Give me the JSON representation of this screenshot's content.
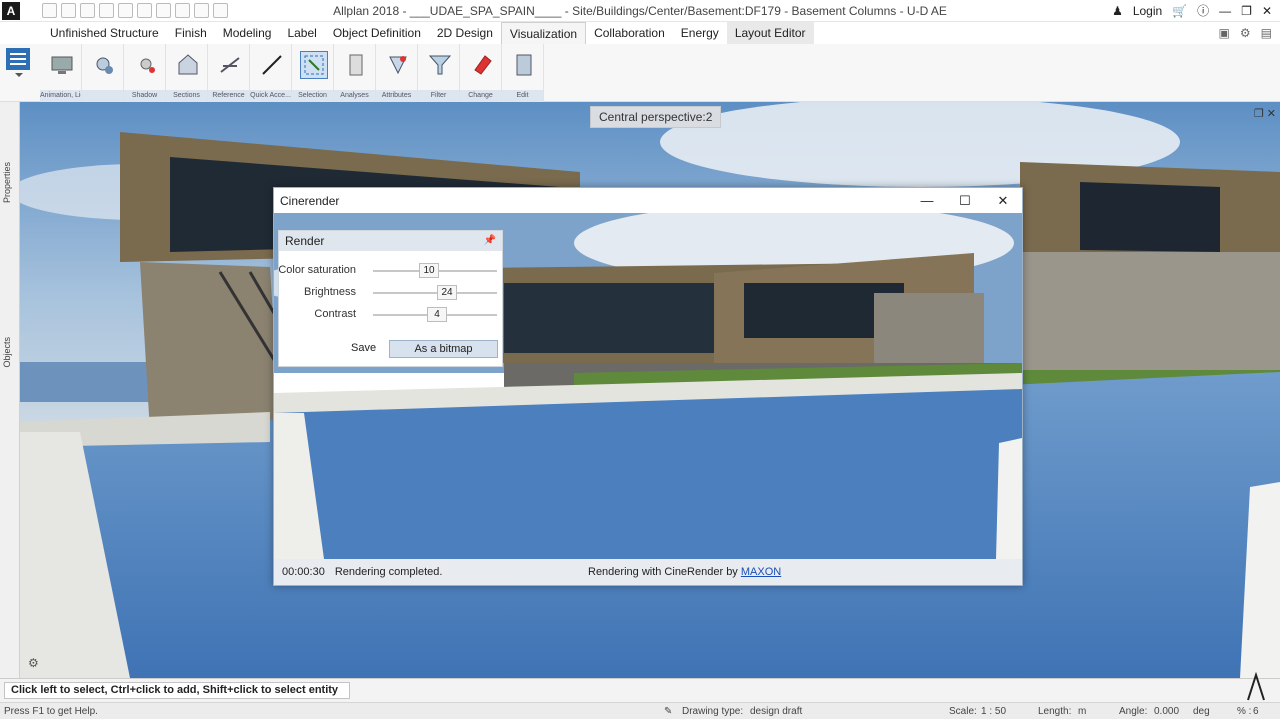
{
  "app": {
    "logo_letter": "A",
    "title": "Allplan 2018 - ___UDAE_SPA_SPAIN____ - Site/Buildings/Center/Basement:DF179 - Basement Columns - U-D AE",
    "login": "Login"
  },
  "ribbon_tabs": [
    {
      "label": "Unfinished Structure"
    },
    {
      "label": "Finish"
    },
    {
      "label": "Modeling"
    },
    {
      "label": "Label"
    },
    {
      "label": "Object Definition"
    },
    {
      "label": "2D Design"
    },
    {
      "label": "Visualization"
    },
    {
      "label": "Collaboration"
    },
    {
      "label": "Energy"
    },
    {
      "label": "Layout Editor"
    }
  ],
  "ribbon_groups": [
    {
      "label": "Animation, Light",
      "icon": "monitor-icon"
    },
    {
      "label": "",
      "icon": "light-settings-icon"
    },
    {
      "label": "Shadow",
      "icon": "sun-icon"
    },
    {
      "label": "Sections",
      "icon": "section-icon"
    },
    {
      "label": "Reference",
      "icon": "reference-icon"
    },
    {
      "label": "Quick Acce...",
      "icon": "line-icon"
    },
    {
      "label": "Selection",
      "icon": "selection-icon"
    },
    {
      "label": "Analyses",
      "icon": "analyses-icon"
    },
    {
      "label": "Attributes",
      "icon": "attributes-icon"
    },
    {
      "label": "Filter",
      "icon": "filter-icon"
    },
    {
      "label": "Change",
      "icon": "eraser-icon"
    },
    {
      "label": "Edit",
      "icon": "copy-icon"
    }
  ],
  "side_panel": {
    "properties": "Properties",
    "objects": "Objects"
  },
  "viewport": {
    "label": "Central perspective:2"
  },
  "cinerender": {
    "title": "Cinerender",
    "render_panel": {
      "title": "Render",
      "rows": [
        {
          "label": "Color saturation",
          "value": "10"
        },
        {
          "label": "Brightness",
          "value": "24"
        },
        {
          "label": "Contrast",
          "value": "4"
        }
      ],
      "save_label": "Save",
      "bitmap_label": "As a bitmap"
    },
    "status": {
      "time": "00:00:30",
      "message": "Rendering completed.",
      "rendering_with": "Rendering with CineRender by",
      "maxon": "MAXON"
    }
  },
  "prompt": "Click left to select, Ctrl+click to add, Shift+click to select entity group",
  "status_bar": {
    "help": "Press F1 to get Help.",
    "drawing_type_label": "Drawing type:",
    "drawing_type_value": "design draft",
    "scale_label": "Scale:",
    "scale_value": "1 : 50",
    "length_label": "Length:",
    "length_value": "m",
    "angle_label": "Angle:",
    "angle_value": "0.000",
    "angle_unit": "deg",
    "percent_label": "% :",
    "percent_value": "6"
  }
}
